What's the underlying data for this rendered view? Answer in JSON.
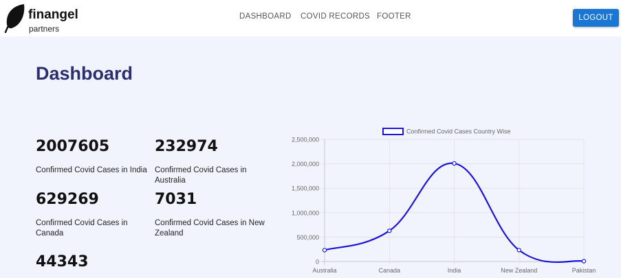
{
  "brand": {
    "name": "finangel",
    "sub": "partners"
  },
  "nav": {
    "items": [
      "DASHBOARD",
      "COVID RECORDS",
      "FOOTER"
    ],
    "logout": "LOGOUT"
  },
  "page": {
    "title": "Dashboard"
  },
  "stats": [
    {
      "value": "2007605",
      "label": "Confirmed Covid Cases in India"
    },
    {
      "value": "232974",
      "label": "Confirmed Covid Cases in Australia"
    },
    {
      "value": "629269",
      "label": "Confirmed Covid Cases in Canada"
    },
    {
      "value": "7031",
      "label": "Confirmed Covid Cases in New Zealand"
    },
    {
      "value": "44343",
      "label": ""
    }
  ],
  "colors": {
    "accent": "#1976d2",
    "title": "#2b2f6e",
    "line": "#1c14d6",
    "background": "#f2f4fd"
  },
  "chart_data": {
    "type": "line",
    "categories": [
      "Australia",
      "Canada",
      "India",
      "New Zealand",
      "Pakistan"
    ],
    "series": [
      {
        "name": "Confirmed Covid Cases Country Wise",
        "values": [
          232974,
          629269,
          2007605,
          232974,
          7031
        ]
      }
    ],
    "yticks": [
      "0",
      "500,000",
      "1,000,000",
      "1,500,000",
      "2,000,000",
      "2,500,000"
    ],
    "ylim": [
      0,
      2500000
    ],
    "grid": true,
    "legend": "top"
  }
}
